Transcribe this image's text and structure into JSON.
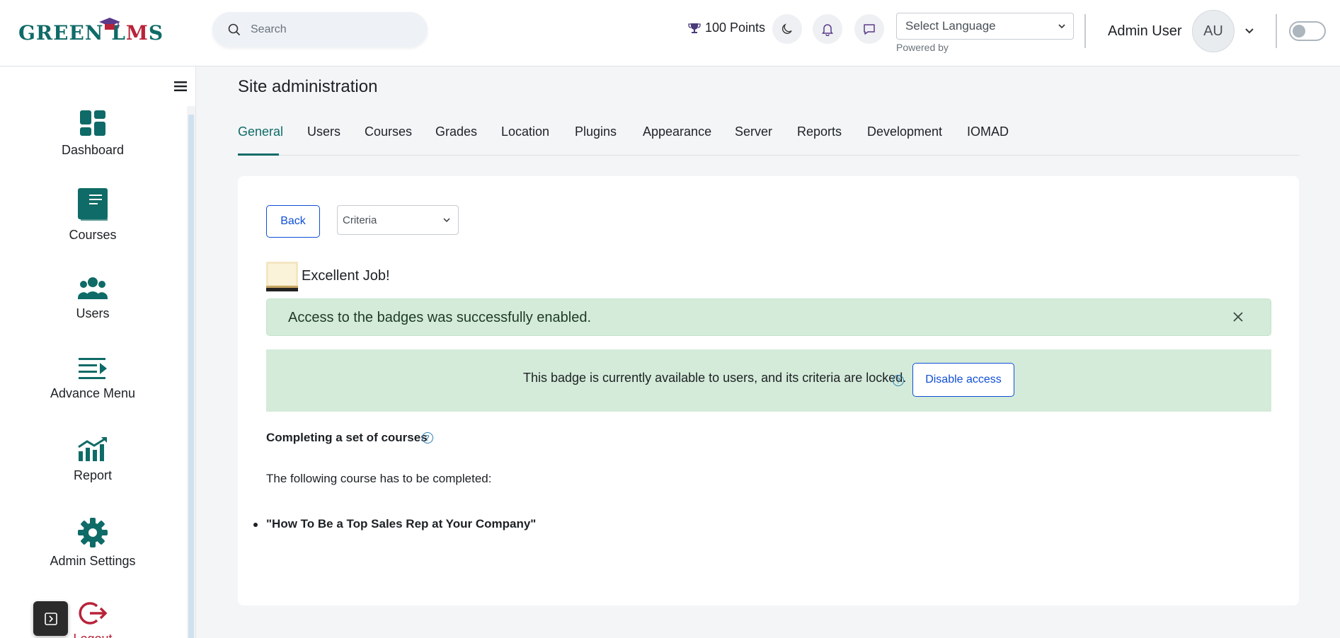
{
  "header": {
    "logo_text_green": "GREEN L",
    "logo_text_m": "M",
    "logo_text_s": "S",
    "search_placeholder": "Search",
    "points": "100 Points",
    "language_select": "Select Language",
    "powered_by": "Powered by",
    "user_name": "Admin User",
    "avatar_initials": "AU"
  },
  "sidebar": {
    "items": [
      {
        "label": "Dashboard",
        "icon": "dashboard-icon"
      },
      {
        "label": "Courses",
        "icon": "book-icon"
      },
      {
        "label": "Users",
        "icon": "users-icon"
      },
      {
        "label": "Advance Menu",
        "icon": "advance-menu-icon"
      },
      {
        "label": "Report",
        "icon": "chart-icon"
      },
      {
        "label": "Admin Settings",
        "icon": "gear-icon"
      },
      {
        "label": "Logout",
        "icon": "logout-icon"
      }
    ]
  },
  "page": {
    "title": "Site administration",
    "tabs": [
      "General",
      "Users",
      "Courses",
      "Grades",
      "Location",
      "Plugins",
      "Appearance",
      "Server",
      "Reports",
      "Development",
      "IOMAD"
    ],
    "active_tab": "General"
  },
  "content": {
    "back_label": "Back",
    "criteria_select": "Criteria",
    "badge_name": "Excellent Job!",
    "alert_message": "Access to the badges was successfully enabled.",
    "status_message": "This badge is currently available to users, and its criteria are locked.",
    "disable_label": "Disable access",
    "criteria_heading": "Completing a set of courses",
    "criteria_description": "The following course has to be completed:",
    "courses": [
      "\"How To Be a Top Sales Rep at Your Company\""
    ]
  },
  "colors": {
    "brand": "#0f6b67",
    "accent_red": "#b8233a",
    "link_blue": "#0f4fd6",
    "success_bg": "#d4ebd9"
  }
}
